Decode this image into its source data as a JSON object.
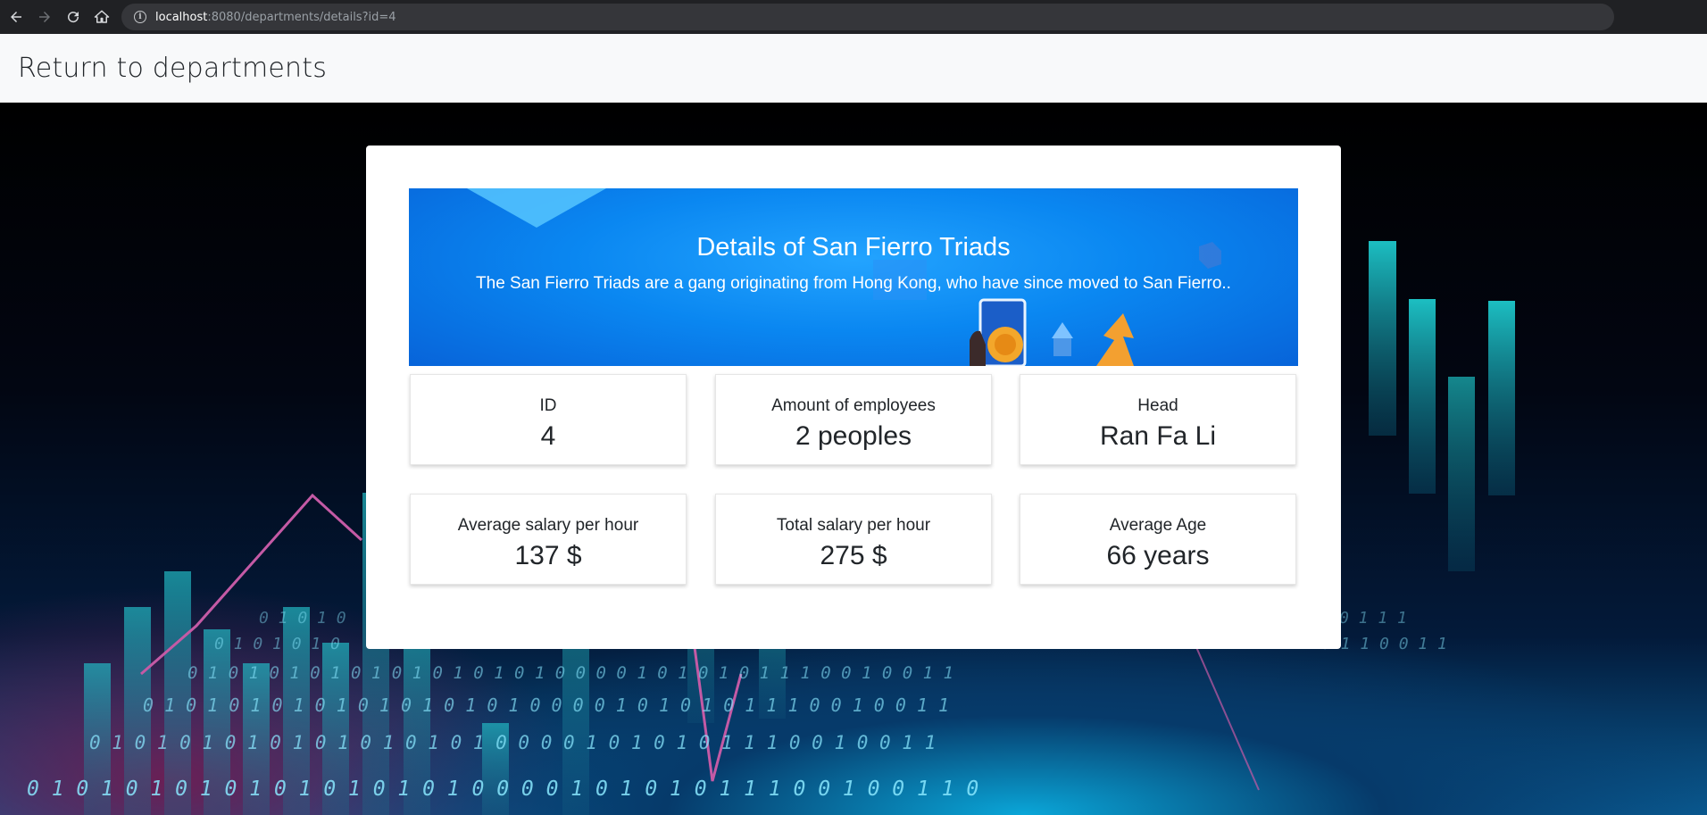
{
  "browser": {
    "url_host": "localhost",
    "url_rest": ":8080/departments/details?id=4",
    "icons": [
      "back-arrow-icon",
      "forward-arrow-icon",
      "reload-icon",
      "home-icon",
      "info-icon"
    ]
  },
  "nav": {
    "return_label": "Return to departments"
  },
  "department": {
    "title": "Details of San Fierro Triads",
    "description": "The San Fierro Triads are a gang originating from Hong Kong, who have since moved to San Fierro.."
  },
  "stats": [
    {
      "label": "ID",
      "value": "4"
    },
    {
      "label": "Amount of employees",
      "value": "2 peoples"
    },
    {
      "label": "Head",
      "value": "Ran Fa Li"
    },
    {
      "label": "Average salary per hour",
      "value": "137 $"
    },
    {
      "label": "Total salary per hour",
      "value": "275 $"
    },
    {
      "label": "Average Age",
      "value": "66 years"
    }
  ],
  "colors": {
    "banner_blue": "#0a87f1",
    "topbar_bg": "#f8f9fa",
    "card_bg": "#ffffff",
    "accent_cyan": "#19c6cf"
  }
}
